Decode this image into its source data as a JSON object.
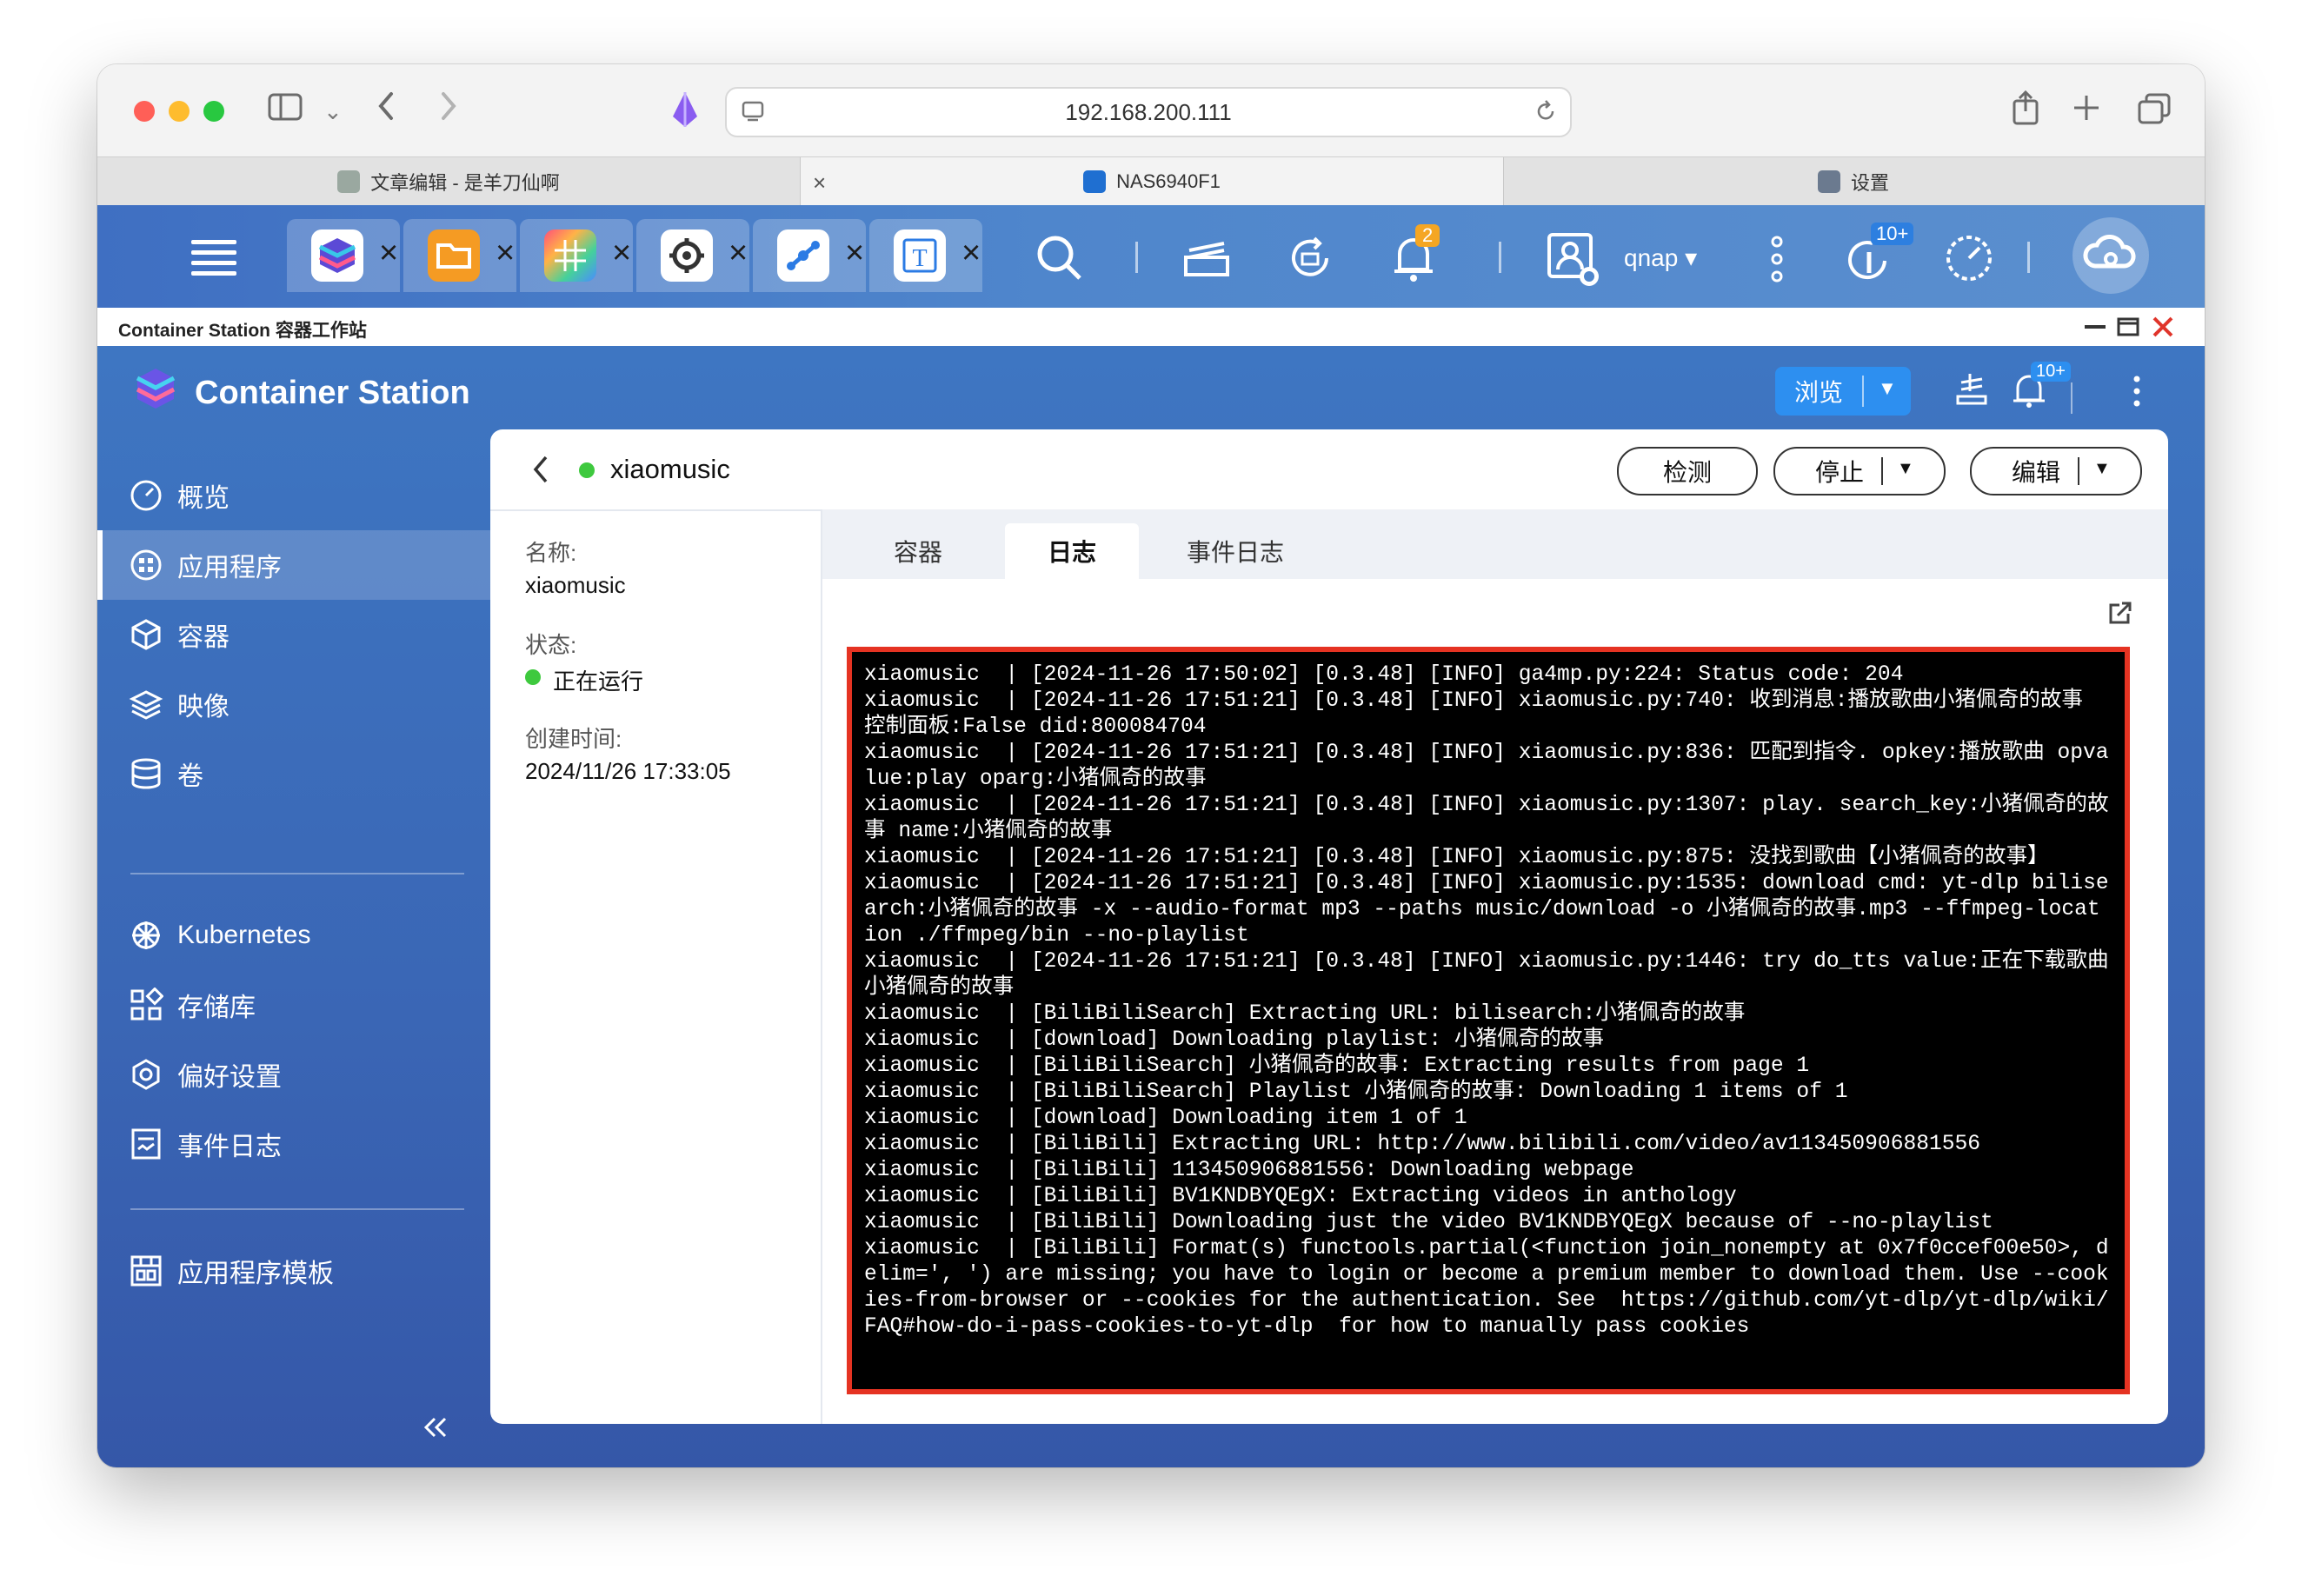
{
  "browser": {
    "url": "192.168.200.111",
    "tabs": [
      {
        "title": "文章编辑 - 是羊刀仙啊"
      },
      {
        "title": "NAS6940F1"
      },
      {
        "title": "设置"
      }
    ]
  },
  "qts": {
    "notifications_badge": "2",
    "user": "qnap ▾",
    "updates_badge": "10+"
  },
  "strip_title": "Container Station 容器工作站",
  "app": {
    "name": "Container Station",
    "browse_label": "浏览",
    "notif_badge": "10+"
  },
  "sidebar": {
    "items": [
      {
        "label": "概览"
      },
      {
        "label": "应用程序"
      },
      {
        "label": "容器"
      },
      {
        "label": "映像"
      },
      {
        "label": "卷"
      },
      {
        "label": "Kubernetes"
      },
      {
        "label": "存储库"
      },
      {
        "label": "偏好设置"
      },
      {
        "label": "事件日志"
      },
      {
        "label": "应用程序模板"
      }
    ]
  },
  "detail": {
    "name": "xiaomusic",
    "buttons": {
      "detect": "检测",
      "stop": "停止",
      "edit": "编辑"
    },
    "info": {
      "name_label": "名称:",
      "name_value": "xiaomusic",
      "status_label": "状态:",
      "status_value": "正在运行",
      "created_label": "创建时间:",
      "created_value": "2024/11/26 17:33:05"
    },
    "tabs": [
      {
        "label": "容器"
      },
      {
        "label": "日志"
      },
      {
        "label": "事件日志"
      }
    ],
    "log": "xiaomusic  | [2024-11-26 17:50:02] [0.3.48] [INFO] ga4mp.py:224: Status code: 204\nxiaomusic  | [2024-11-26 17:51:21] [0.3.48] [INFO] xiaomusic.py:740: 收到消息:播放歌曲小猪佩奇的故事 控制面板:False did:800084704\nxiaomusic  | [2024-11-26 17:51:21] [0.3.48] [INFO] xiaomusic.py:836: 匹配到指令. opkey:播放歌曲 opvalue:play oparg:小猪佩奇的故事\nxiaomusic  | [2024-11-26 17:51:21] [0.3.48] [INFO] xiaomusic.py:1307: play. search_key:小猪佩奇的故事 name:小猪佩奇的故事\nxiaomusic  | [2024-11-26 17:51:21] [0.3.48] [INFO] xiaomusic.py:875: 没找到歌曲【小猪佩奇的故事】\nxiaomusic  | [2024-11-26 17:51:21] [0.3.48] [INFO] xiaomusic.py:1535: download cmd: yt-dlp bilisearch:小猪佩奇的故事 -x --audio-format mp3 --paths music/download -o 小猪佩奇的故事.mp3 --ffmpeg-location ./ffmpeg/bin --no-playlist\nxiaomusic  | [2024-11-26 17:51:21] [0.3.48] [INFO] xiaomusic.py:1446: try do_tts value:正在下载歌曲小猪佩奇的故事\nxiaomusic  | [BiliBiliSearch] Extracting URL: bilisearch:小猪佩奇的故事\nxiaomusic  | [download] Downloading playlist: 小猪佩奇的故事\nxiaomusic  | [BiliBiliSearch] 小猪佩奇的故事: Extracting results from page 1\nxiaomusic  | [BiliBiliSearch] Playlist 小猪佩奇的故事: Downloading 1 items of 1\nxiaomusic  | [download] Downloading item 1 of 1\nxiaomusic  | [BiliBili] Extracting URL: http://www.bilibili.com/video/av113450906881556\nxiaomusic  | [BiliBili] 113450906881556: Downloading webpage\nxiaomusic  | [BiliBili] BV1KNDBYQEgX: Extracting videos in anthology\nxiaomusic  | [BiliBili] Downloading just the video BV1KNDBYQEgX because of --no-playlist\nxiaomusic  | [BiliBili] Format(s) functools.partial(<function join_nonempty at 0x7f0ccef00e50>, delim=', ') are missing; you have to login or become a premium member to download them. Use --cookies-from-browser or --cookies for the authentication. See  https://github.com/yt-dlp/yt-dlp/wiki/FAQ#how-do-i-pass-cookies-to-yt-dlp  for how to manually pass cookies"
  },
  "colors": {
    "accent_blue": "#3e76c2",
    "running_green": "#3ec93e",
    "console_border": "#e53322",
    "badge_orange": "#f5a623"
  }
}
